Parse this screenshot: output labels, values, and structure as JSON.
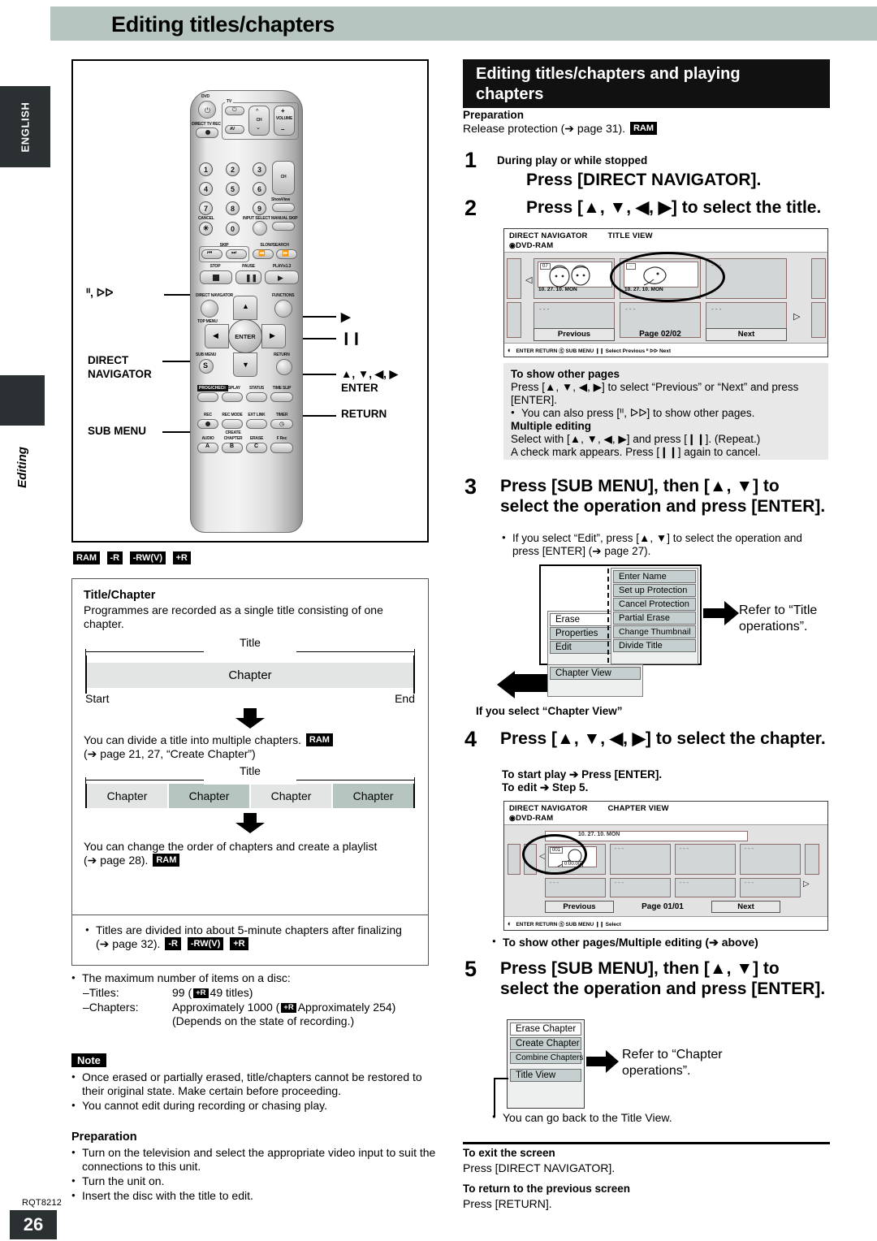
{
  "page": {
    "title": "Editing titles/chapters",
    "side_tab_language": "ENGLISH",
    "side_tab_section": "Editing",
    "footer_code": "RQT8212",
    "footer_page": "26"
  },
  "remote": {
    "callouts_left": [
      {
        "name": "skip",
        "label": "ᑊᑊ, ᐅᐅ"
      },
      {
        "name": "direct-navigator",
        "label_line1": "DIRECT",
        "label_line2": "NAVIGATOR"
      },
      {
        "name": "sub-menu",
        "label": "SUB MENU"
      }
    ],
    "callouts_right": [
      {
        "name": "play",
        "label": "▶"
      },
      {
        "name": "pause",
        "label": "❙❙"
      },
      {
        "name": "cursor-enter",
        "label_line1": "▲, ▼, ◀, ▶",
        "label_line2": "ENTER"
      },
      {
        "name": "return",
        "label": "RETURN"
      }
    ],
    "labels": {
      "dvd": "DVD",
      "tv": "TV",
      "direct_tv_rec": "DIRECT TV REC",
      "av": "AV",
      "ch": "CH",
      "volume": "VOLUME",
      "showview": "ShowView",
      "cancel": "CANCEL",
      "input_select": "INPUT SELECT",
      "manual_skip": "MANUAL SKIP",
      "skip": "SKIP",
      "slow_search": "SLOW/SEARCH",
      "stop": "STOP",
      "pause": "PAUSE",
      "play": "PLAY/x1.3",
      "direct_navigator": "DIRECT NAVIGATOR",
      "functions": "FUNCTIONS",
      "top_menu": "TOP MENU",
      "sub_menu": "SUB MENU",
      "return": "RETURN",
      "enter": "ENTER",
      "prog_check": "PROG/CHECK",
      "display": "DISPLAY",
      "status": "STATUS",
      "time_slip": "TIME SLIP",
      "rec": "REC",
      "rec_mode": "REC MODE",
      "ext_link": "EXT LINK",
      "timer": "TIMER",
      "audio": "AUDIO",
      "create_chapter_1": "CREATE",
      "create_chapter_2": "CHAPTER",
      "erase": "ERASE",
      "f_rec": "F Rec",
      "btn_a": "A",
      "btn_b": "B",
      "btn_c": "C",
      "numbers": [
        "1",
        "2",
        "3",
        "4",
        "5",
        "6",
        "7",
        "8",
        "9",
        "✳",
        "0"
      ]
    }
  },
  "left": {
    "disc_badges": [
      "RAM",
      "-R",
      "-RW(V)",
      "+R"
    ],
    "title_chapter": {
      "heading": "Title/Chapter",
      "intro": "Programmes are recorded as a single title consisting of one chapter.",
      "diagram1": {
        "title_label": "Title",
        "chapter_label": "Chapter",
        "start_label": "Start",
        "end_label": "End"
      },
      "divide_text": "You can divide a title into multiple chapters.",
      "divide_badge": "RAM",
      "divide_ref": "(➔ page 21, 27, “Create Chapter”)",
      "diagram2": {
        "title_label": "Title",
        "chapters": [
          "Chapter",
          "Chapter",
          "Chapter",
          "Chapter"
        ]
      },
      "playlist_text": "You can change the order of chapters and create a playlist",
      "playlist_ref": "(➔ page 28).",
      "playlist_badge": "RAM",
      "finalize_note": "Titles are divided into about 5-minute chapters after finalizing",
      "finalize_ref": "(➔ page 32).",
      "finalize_badges": [
        "-R",
        "-RW(V)",
        "+R"
      ]
    },
    "max_items": {
      "intro": "The maximum number of items on a disc:",
      "rows": [
        {
          "label": "–Titles:",
          "value_pre": "99 (",
          "badge": "+R",
          "value_post": "49 titles)"
        },
        {
          "label": "–Chapters:",
          "value_pre": "Approximately 1000 (",
          "badge": "+R",
          "value_post": "Approximately 254)"
        }
      ],
      "depends": "(Depends on the state of recording.)"
    },
    "note": {
      "badge": "Note",
      "items": [
        "Once erased or partially erased, title/chapters cannot be restored to their original state. Make certain before proceeding.",
        "You cannot edit during recording or chasing play."
      ]
    },
    "preparation": {
      "heading": "Preparation",
      "items": [
        "Turn on the television and select the appropriate video input to suit the connections to this unit.",
        "Turn the unit on.",
        "Insert the disc with the title to edit."
      ]
    }
  },
  "right": {
    "section_title_line1": "Editing titles/chapters and playing",
    "section_title_line2": "chapters",
    "preparation": {
      "heading": "Preparation",
      "text": "Release protection (➔ page 31).",
      "badge": "RAM"
    },
    "step1": {
      "num": "1",
      "cue": "During play or while stopped",
      "text": "Press [DIRECT NAVIGATOR]."
    },
    "step2": {
      "num": "2",
      "text": "Press [▲, ▼, ◀, ▶] to select the title."
    },
    "title_view_osd": {
      "header_left": "DIRECT NAVIGATOR",
      "header_right": "TITLE VIEW",
      "disc": "DVD-RAM",
      "thumb1_num": "07",
      "thumb1_date": "10. 27. 10. MON",
      "thumb2_date": "10. 27. 10. MON",
      "placeholder": "- - -",
      "previous": "Previous",
      "page": "Page 02/02",
      "next": "Next",
      "footer": "ENTER  RETURN   Ⓢ SUB MENU  ❙❙ Select   Previous ᑊᑊ  ᐅᐅ Next"
    },
    "tips": {
      "heading1": "To show other pages",
      "text1": "Press [▲, ▼, ◀, ▶] to select “Previous” or “Next” and press [ENTER].",
      "bullet1": "You can also press [ᑊᑊ, ᐅᐅ] to show other pages.",
      "heading2": "Multiple editing",
      "text2": "Select with [▲, ▼, ◀, ▶] and press [❙❙]. (Repeat.)",
      "text3": "A check mark appears. Press [❙❙] again to cancel."
    },
    "step3": {
      "num": "3",
      "text": "Press [SUB MENU], then [▲, ▼] to select the operation and press [ENTER].",
      "bullet": "If you select “Edit”, press [▲, ▼] to select the operation and press [ENTER] (➔ page 27)."
    },
    "title_menu": {
      "main_items": [
        "Erase",
        "Properties",
        "Edit"
      ],
      "sub_items": [
        "Enter Name",
        "Set up Protection",
        "Cancel Protection",
        "Partial Erase",
        "Change Thumbnail",
        "Divide Title"
      ],
      "chapter_view_item": "Chapter View",
      "refer_line1": "Refer to “Title",
      "refer_line2": "operations”.",
      "if_select": "If you select “Chapter View”"
    },
    "step4": {
      "num": "4",
      "text": "Press [▲, ▼, ◀, ▶] to select the chapter.",
      "sub1": "To start play ➔ Press [ENTER].",
      "sub2": "To edit ➔ Step 5."
    },
    "chapter_view_osd": {
      "header_left": "DIRECT NAVIGATOR",
      "header_right": "CHAPTER VIEW",
      "disc": "DVD-RAM",
      "row_title": "10. 27. 10. MON",
      "chapter_num": "001",
      "chapter_time": "0:00.00",
      "placeholder": "- - -",
      "previous": "Previous",
      "page": "Page 01/01",
      "next": "Next",
      "footer": "ENTER  RETURN   Ⓢ SUB MENU  ❙❙ Select"
    },
    "chapter_tip": "To show other pages/Multiple editing (➔ above)",
    "step5": {
      "num": "5",
      "text": "Press [SUB MENU], then [▲, ▼] to select the operation and press [ENTER]."
    },
    "chapter_menu": {
      "items": [
        "Erase Chapter",
        "Create Chapter",
        "Combine Chapters",
        "Title View"
      ],
      "refer_line1": "Refer to “Chapter",
      "refer_line2": "operations”.",
      "back_note": "You can go back to the Title View."
    },
    "exit": {
      "heading1": "To exit the screen",
      "text1": "Press [DIRECT NAVIGATOR].",
      "heading2": "To return to the previous screen",
      "text2": "Press [RETURN]."
    }
  }
}
